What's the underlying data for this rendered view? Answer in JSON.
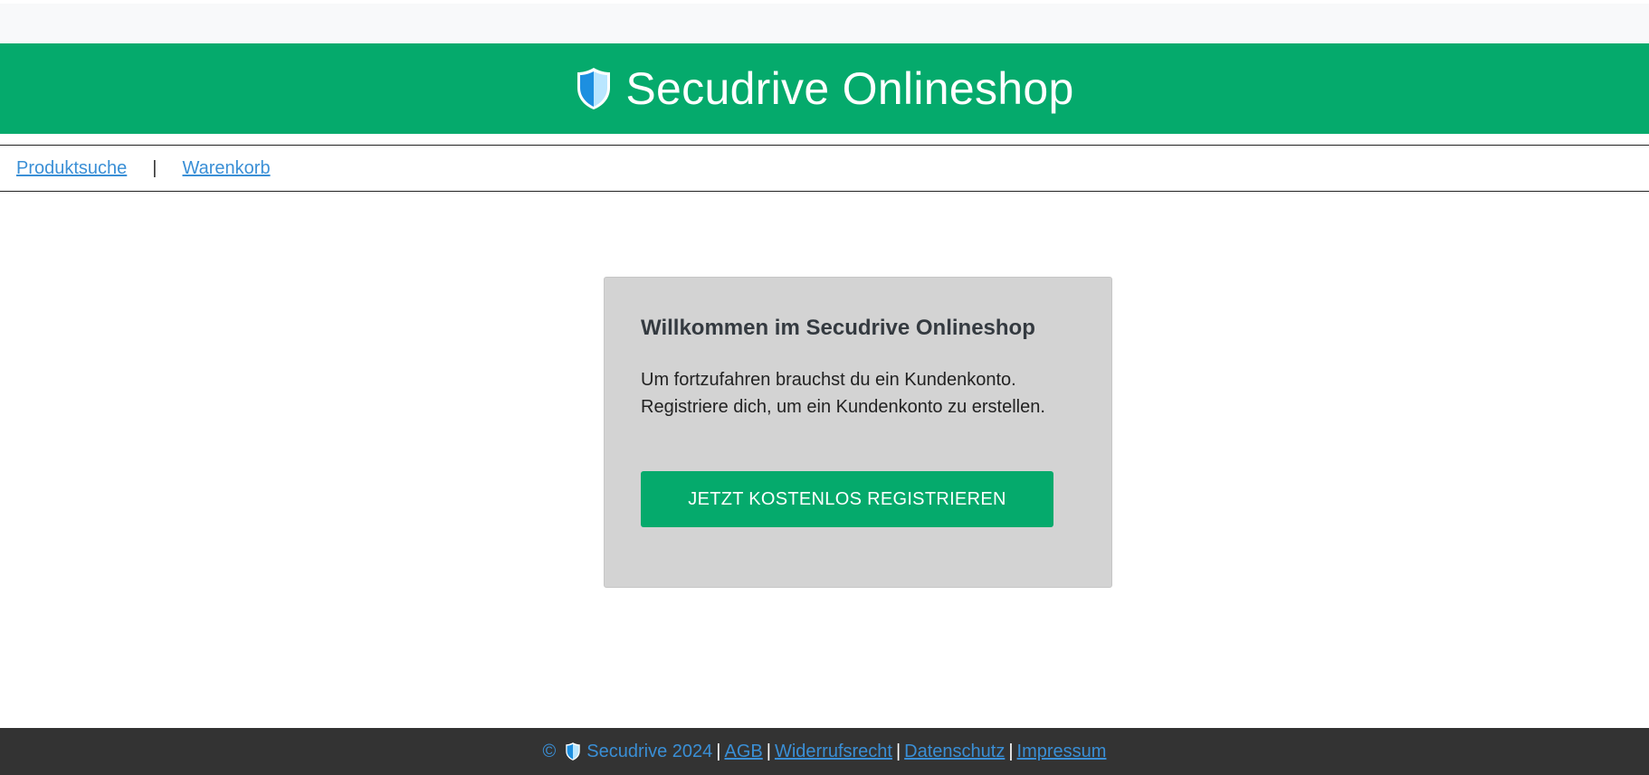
{
  "header": {
    "title": "Secudrive Onlineshop",
    "logo_icon": "shield-icon",
    "background_color": "#05aa6c"
  },
  "nav": {
    "items": [
      {
        "label": "Produktsuche"
      },
      {
        "label": "Warenkorb"
      }
    ],
    "separator": "|"
  },
  "card": {
    "heading": "Willkommen im Secudrive Onlineshop",
    "line1": "Um fortzufahren brauchst du ein Kundenkonto.",
    "line2": "Registriere dich, um ein Kundenkonto zu erstellen.",
    "button_label": "JETZT KOSTENLOS REGISTRIEREN"
  },
  "footer": {
    "copyright_symbol": "©",
    "brand_year": "Secudrive 2024",
    "links": [
      {
        "label": "AGB "
      },
      {
        "label": "Widerrufsrecht "
      },
      {
        "label": "Datenschutz "
      },
      {
        "label": "Impressum"
      }
    ],
    "separator": "|"
  },
  "colors": {
    "brand_green": "#05aa6c",
    "link_blue": "#3a8fd6",
    "footer_bg": "#333333",
    "card_bg": "#d3d3d3"
  }
}
